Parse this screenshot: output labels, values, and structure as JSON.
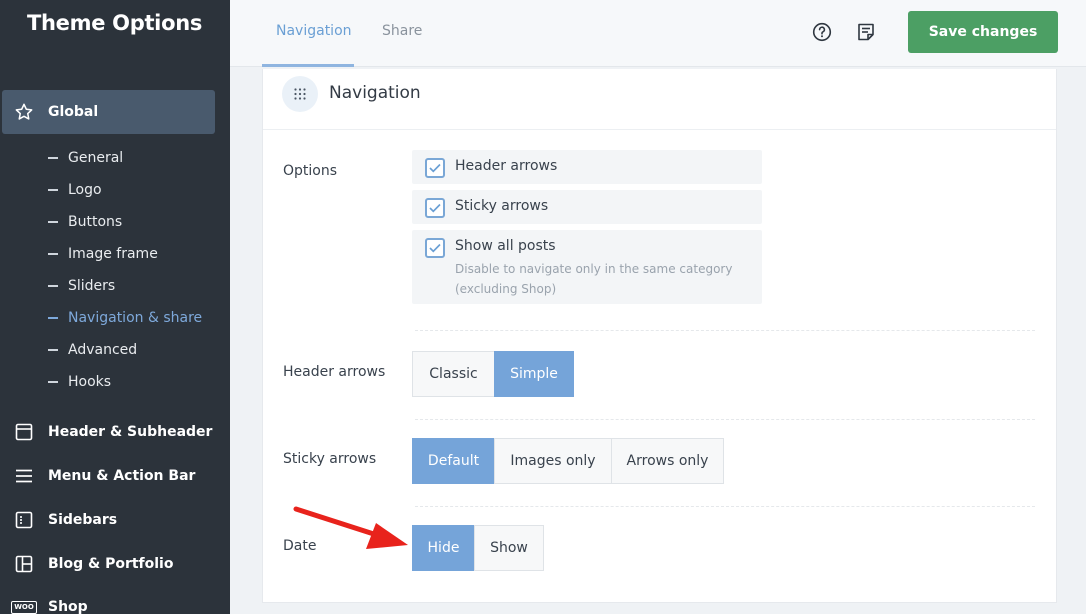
{
  "sidebar": {
    "title": "Theme Options",
    "global_label": "Global",
    "sub_items": [
      {
        "label": "General"
      },
      {
        "label": "Logo"
      },
      {
        "label": "Buttons"
      },
      {
        "label": "Image frame"
      },
      {
        "label": "Sliders"
      },
      {
        "label": "Navigation & share",
        "active": true
      },
      {
        "label": "Advanced"
      },
      {
        "label": "Hooks"
      }
    ],
    "main_items": [
      {
        "label": "Header & Subheader",
        "icon": "layout-header-icon"
      },
      {
        "label": "Menu & Action Bar",
        "icon": "hamburger-menu-icon"
      },
      {
        "label": "Sidebars",
        "icon": "sidebar-layout-icon"
      },
      {
        "label": "Blog & Portfolio",
        "icon": "blog-grid-icon"
      },
      {
        "label": "Shop",
        "icon": "woo-icon",
        "badge": "WOO"
      }
    ]
  },
  "header": {
    "tabs": [
      {
        "label": "Navigation",
        "active": true
      },
      {
        "label": "Share"
      }
    ],
    "help_icon": "question-circle-icon",
    "notes_icon": "notes-icon",
    "save_label": "Save changes"
  },
  "panel": {
    "title": "Navigation",
    "icon": "grid-dots-icon",
    "options": {
      "label": "Options",
      "items": [
        {
          "label": "Header arrows",
          "checked": true
        },
        {
          "label": "Sticky arrows",
          "checked": true
        },
        {
          "label": "Show all posts",
          "checked": true,
          "description": "Disable to navigate only in the same category (excluding Shop)"
        }
      ]
    },
    "header_arrows": {
      "label": "Header arrows",
      "options": [
        "Classic",
        "Simple"
      ],
      "selected": "Simple"
    },
    "sticky_arrows": {
      "label": "Sticky arrows",
      "options": [
        "Default",
        "Images only",
        "Arrows only"
      ],
      "selected": "Default"
    },
    "date": {
      "label": "Date",
      "options": [
        "Hide",
        "Show"
      ],
      "selected": "Hide"
    }
  },
  "colors": {
    "sidebar_bg": "#2c333b",
    "accent": "#75a4d9",
    "save_button": "#4c9f64",
    "annotation_arrow": "#e8231c"
  }
}
